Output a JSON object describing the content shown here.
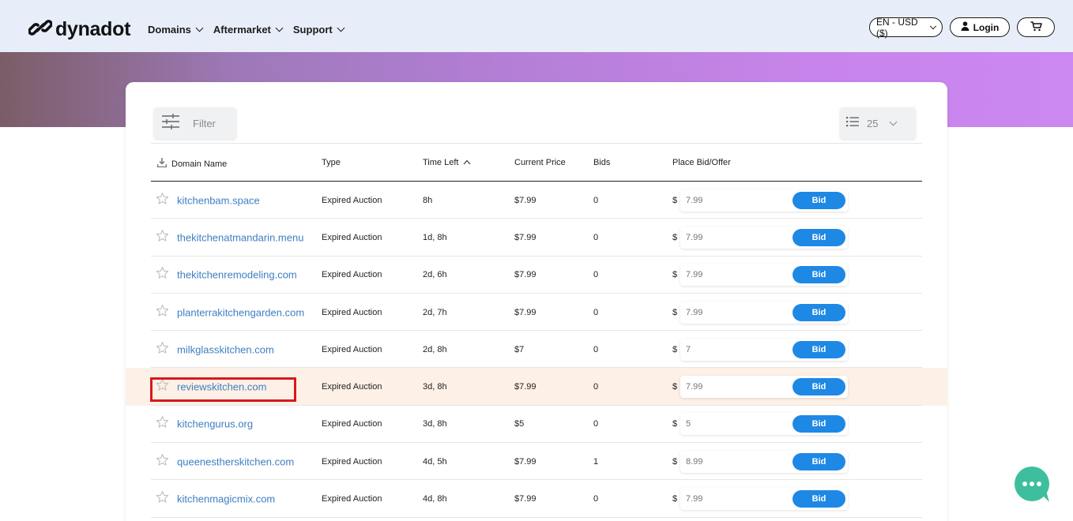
{
  "header": {
    "logo_text": "dynadot",
    "nav": [
      "Domains",
      "Aftermarket",
      "Support"
    ],
    "language": "EN - USD ($)",
    "login_label": "Login"
  },
  "toolbar": {
    "filter_label": "Filter",
    "page_size": "25"
  },
  "table": {
    "columns": {
      "domain": "Domain Name",
      "type": "Type",
      "time_left": "Time Left",
      "price": "Current Price",
      "bids": "Bids",
      "place_bid": "Place Bid/Offer"
    },
    "currency_symbol": "$",
    "bid_label": "Bid",
    "rows": [
      {
        "domain": "kitchenbam.space",
        "type": "Expired Auction",
        "time_left": "8h",
        "price": "$7.99",
        "bids": "0",
        "bid_placeholder": "7.99"
      },
      {
        "domain": "thekitchenatmandarin.menu",
        "type": "Expired Auction",
        "time_left": "1d, 8h",
        "price": "$7.99",
        "bids": "0",
        "bid_placeholder": "7.99"
      },
      {
        "domain": "thekitchenremodeling.com",
        "type": "Expired Auction",
        "time_left": "2d, 6h",
        "price": "$7.99",
        "bids": "0",
        "bid_placeholder": "7.99"
      },
      {
        "domain": "planterrakitchengarden.com",
        "type": "Expired Auction",
        "time_left": "2d, 7h",
        "price": "$7.99",
        "bids": "0",
        "bid_placeholder": "7.99"
      },
      {
        "domain": "milkglasskitchen.com",
        "type": "Expired Auction",
        "time_left": "2d, 8h",
        "price": "$7",
        "bids": "0",
        "bid_placeholder": "7"
      },
      {
        "domain": "reviewskitchen.com",
        "type": "Expired Auction",
        "time_left": "3d, 8h",
        "price": "$7.99",
        "bids": "0",
        "bid_placeholder": "7.99"
      },
      {
        "domain": "kitchengurus.org",
        "type": "Expired Auction",
        "time_left": "3d, 8h",
        "price": "$5",
        "bids": "0",
        "bid_placeholder": "5"
      },
      {
        "domain": "queenestherskitchen.com",
        "type": "Expired Auction",
        "time_left": "4d, 5h",
        "price": "$7.99",
        "bids": "1",
        "bid_placeholder": "8.99"
      },
      {
        "domain": "kitchenmagicmix.com",
        "type": "Expired Auction",
        "time_left": "4d, 8h",
        "price": "$7.99",
        "bids": "0",
        "bid_placeholder": "7.99"
      }
    ]
  },
  "icons": {
    "logo": "dynadot-link-logo-icon",
    "login": "user-icon",
    "cart": "cart-icon",
    "filter": "sliders-icon",
    "list": "list-icon",
    "download": "download-icon",
    "sort": "sort-up-icon",
    "star": "star-outline-icon",
    "chat": "chat-bubble-icon"
  },
  "colors": {
    "accent": "#1e88e5",
    "link": "#3e7fc1",
    "highlight_row": "#fdf0e6",
    "annotation": "#d7191c",
    "chat": "#3dbf9e"
  }
}
